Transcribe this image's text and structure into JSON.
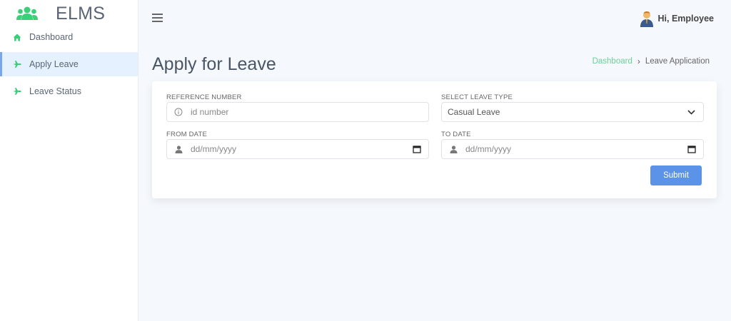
{
  "brand": {
    "name": "ELMS",
    "logo_icon": "users-icon",
    "accent": "#3ccf7a"
  },
  "sidebar": {
    "items": [
      {
        "label": "Dashboard",
        "icon": "home-icon",
        "active": false
      },
      {
        "label": "Apply Leave",
        "icon": "plane-icon",
        "active": true
      },
      {
        "label": "Leave Status",
        "icon": "plane-icon",
        "active": false
      }
    ]
  },
  "header": {
    "menu_icon": "hamburger-icon",
    "greeting": "Hi, Employee",
    "avatar_icon": "user-avatar-icon"
  },
  "page": {
    "title": "Apply for Leave",
    "breadcrumb": {
      "link": "Dashboard",
      "current": "Leave Application"
    }
  },
  "form": {
    "reference": {
      "label": "REFERENCE NUMBER",
      "placeholder": "id number",
      "icon": "info-icon"
    },
    "leave_type": {
      "label": "SELECT LEAVE TYPE",
      "value": "Casual Leave"
    },
    "from_date": {
      "label": "FROM DATE",
      "placeholder": "dd/mm/yyyy",
      "icon": "person-icon"
    },
    "to_date": {
      "label": "TO DATE",
      "placeholder": "dd/mm/yyyy",
      "icon": "person-icon"
    },
    "submit_label": "Submit"
  },
  "colors": {
    "primary_button": "#5b93e8",
    "breadcrumb_link": "#6fcf97",
    "active_nav_bg": "#e6f1ff"
  }
}
